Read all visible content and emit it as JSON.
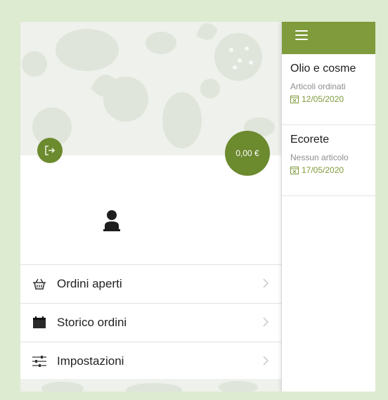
{
  "drawer": {
    "balance": "0,00 €",
    "menu": [
      {
        "label": "Ordini aperti",
        "icon": "basket-icon"
      },
      {
        "label": "Storico ordini",
        "icon": "calendar-icon"
      },
      {
        "label": "Impostazioni",
        "icon": "sliders-icon"
      }
    ]
  },
  "main": {
    "orders": [
      {
        "title": "Olio e cosme",
        "subtitle": "Articoli ordinati",
        "date": "12/05/2020"
      },
      {
        "title": "Ecorete",
        "subtitle": "Nessun articolo",
        "date": "17/05/2020"
      }
    ]
  },
  "colors": {
    "accent": "#6c8a2e",
    "topbar": "#7f9b3b",
    "background": "#ddebd0"
  }
}
